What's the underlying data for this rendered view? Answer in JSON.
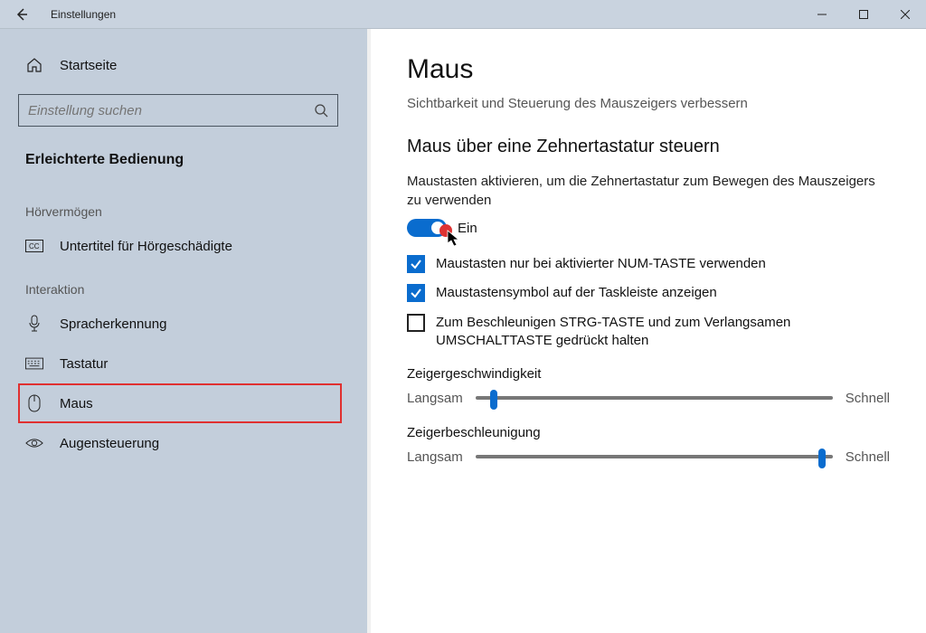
{
  "titlebar": {
    "title": "Einstellungen"
  },
  "sidebar": {
    "home": "Startseite",
    "search_placeholder": "Einstellung suchen",
    "main_heading": "Erleichterte Bedienung",
    "section_hearing": "Hörvermögen",
    "item_captions": "Untertitel für Hörgeschädigte",
    "section_interaction": "Interaktion",
    "item_speech": "Spracherkennung",
    "item_keyboard": "Tastatur",
    "item_mouse": "Maus",
    "item_eye": "Augensteuerung"
  },
  "content": {
    "title": "Maus",
    "subtitle": "Sichtbarkeit und Steuerung des Mauszeigers verbessern",
    "section_keypad": "Maus über eine Zehnertastatur steuern",
    "toggle_desc": "Maustasten aktivieren, um die Zehnertastatur zum Bewegen des Mauszeigers zu verwenden",
    "toggle_state": "Ein",
    "chk1": "Maustasten nur bei aktivierter NUM-TASTE verwenden",
    "chk2": "Maustastensymbol auf der Taskleiste anzeigen",
    "chk3": "Zum Beschleunigen STRG-TASTE und zum Verlangsamen UMSCHALTTASTE gedrückt halten",
    "slider1_title": "Zeigergeschwindigkeit",
    "slider2_title": "Zeigerbeschleunigung",
    "slow": "Langsam",
    "fast": "Schnell",
    "slider1_pct": 4,
    "slider2_pct": 96
  }
}
